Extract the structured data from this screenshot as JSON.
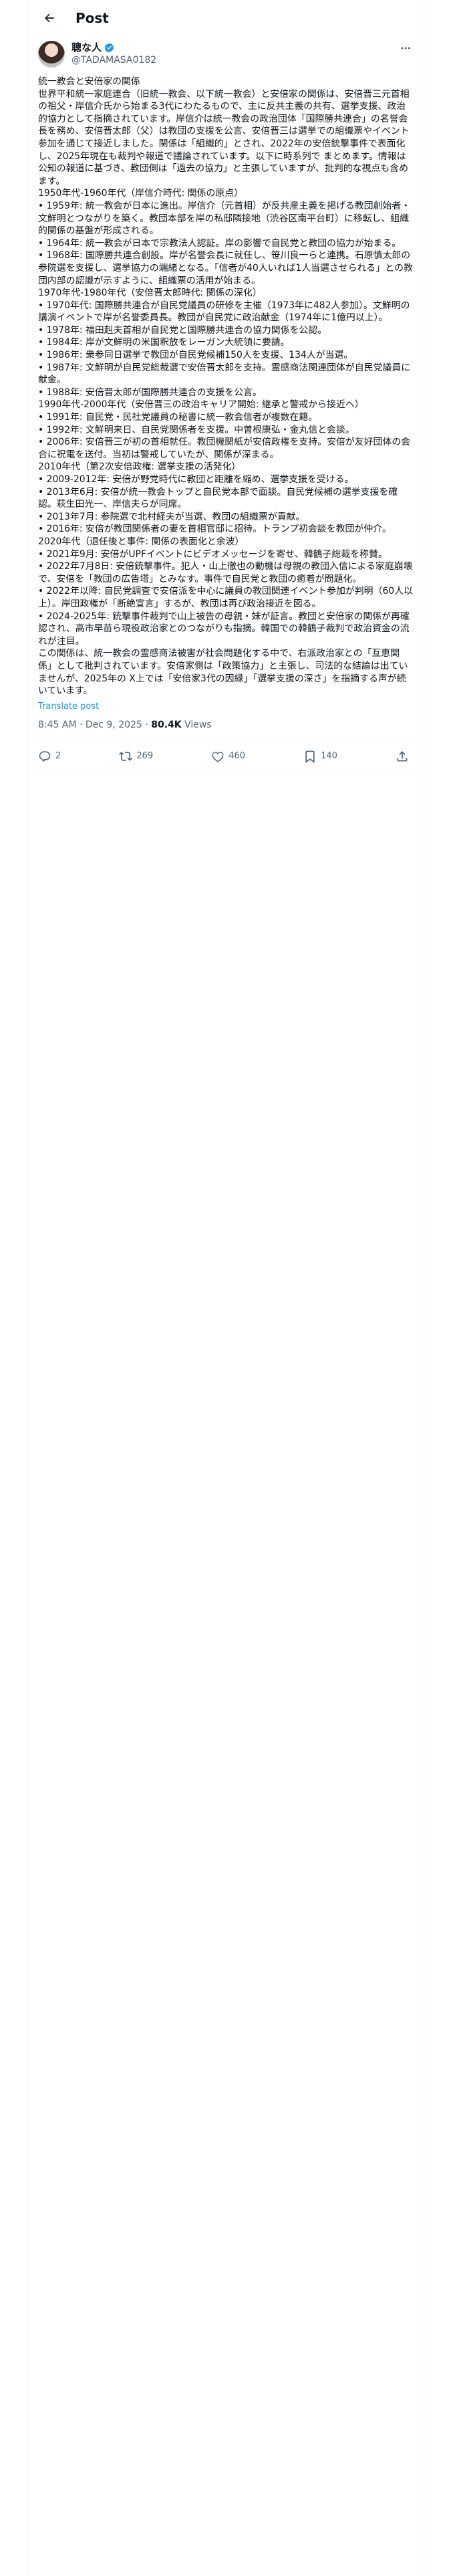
{
  "header": {
    "title": "Post"
  },
  "author": {
    "name": "聰な人",
    "handle": "@TADAMASA0182",
    "verified_color": "#1d9bf0"
  },
  "tweet": {
    "lines": [
      "統一教会と安倍家の関係",
      "世界平和統一家庭連合（旧統一教会、以下統一教会）と安倍家の関係は、安倍晋三元首相の祖父・岸信介氏から始まる3代にわたるもので、主に反共主義の共有、選挙支援、政治的協力として指摘されています。岸信介は統一教会の政治団体「国際勝共連合」の名誉会長を務め、安倍晋太郎（父）は教団の支援を公言、安倍晋三は選挙での組織票やイベント参加を通じて接近しました。関係は「組織的」とされ、2022年の安倍銃撃事件で表面化し、2025年現在も裁判や報道で議論されています。以下に時系列で まとめます。情報は公知の報道に基づき、教団側は「過去の協力」と主張していますが、批判的な視点も含めます。",
      "1950年代-1960年代（岸信介時代: 関係の原点）",
      "• 1959年: 統一教会が日本に進出。岸信介（元首相）が反共産主義を掲げる教団創始者・文鮮明とつながりを築く。教団本部を岸の私邸隣接地（渋谷区南平台町）に移転し、組織的関係の基盤が形成される。",
      "• 1964年: 統一教会が日本で宗教法人認証。岸の影響で自民党と教団の協力が始まる。",
      "• 1968年: 国際勝共連合創設。岸が名誉会長に就任し、笹川良一らと連携。石原慎太郎の参院選を支援し、選挙協力の端緒となる。「信者が40人いれば1人当選させられる」との教団内部の認識が示すように、組織票の活用が始まる。",
      "1970年代-1980年代（安倍晋太郎時代: 関係の深化）",
      "• 1970年代: 国際勝共連合が自民党議員の研修を主催（1973年に482人参加）。文鮮明の講演イベントで岸が名誉委員長。教団が自民党に政治献金（1974年に1億円以上）。",
      "• 1978年: 福田赳夫首相が自民党と国際勝共連合の協力関係を公認。",
      "• 1984年: 岸が文鮮明の米国釈放をレーガン大統領に要請。",
      "• 1986年: 衆参同日選挙で教団が自民党候補150人を支援、134人が当選。",
      "• 1987年: 文鮮明が自民党総裁選で安倍晋太郎を支持。霊感商法関連団体が自民党議員に献金。",
      "• 1988年: 安倍晋太郎が国際勝共連合の支援を公言。",
      "1990年代-2000年代（安倍晋三の政治キャリア開始: 継承と警戒から接近へ）",
      "• 1991年: 自民党・民社党議員の秘書に統一教会信者が複数在籍。",
      "• 1992年: 文鮮明来日、自民党関係者を支援。中曽根康弘・金丸信と会談。",
      "• 2006年: 安倍晋三が初の首相就任。教団機関紙が安倍政権を支持。安倍が友好団体の会合に祝電を送付。当初は警戒していたが、関係が深まる。",
      "2010年代（第2次安倍政権: 選挙支援の活発化）",
      "• 2009-2012年: 安倍が野党時代に教団と距離を縮め、選挙支援を受ける。",
      "• 2013年6月: 安倍が統一教会トップと自民党本部で面談。自民党候補の選挙支援を確認。萩生田光一、岸信夫らが同席。",
      "• 2013年7月: 参院選で北村経夫が当選、教団の組織票が貢献。",
      "• 2016年: 安倍が教団関係者の妻を首相官邸に招待。トランプ初会談を教団が仲介。",
      "2020年代（退任後と事件: 関係の表面化と余波）",
      "• 2021年9月: 安倍がUPFイベントにビデオメッセージを寄せ、韓鶴子総裁を称賛。",
      "• 2022年7月8日: 安倍銃撃事件。犯人・山上徹也の動機は母親の教団入信による家庭崩壊で、安倍を「教団の広告塔」とみなす。事件で自民党と教団の癒着が問題化。",
      "• 2022年以降: 自民党調査で安倍派を中心に議員の教団関連イベント参加が判明（60人以上）。岸田政権が「断絶宣言」するが、教団は再び政治接近を図る。",
      "• 2024-2025年: 銃撃事件裁判で山上被告の母親・妹が証言。教団と安倍家の関係が再確認され、高市早苗ら現役政治家とのつながりも指摘。韓国での韓鶴子裁判で政治資金の流れが注目。",
      "この関係は、統一教会の霊感商法被害が社会問題化する中で、右派政治家との「互恵関係」として批判されています。安倍家側は「政策協力」と主張し、司法的な結論は出ていませんが、2025年の X上では「安倍家3代の因縁」「選挙支援の深さ」を指摘する声が続いています。"
    ],
    "translate_label": "Translate post",
    "timestamp": "8:45 AM · Dec 9, 2025",
    "separator": " · ",
    "views_count": "80.4K",
    "views_label": " Views"
  },
  "actions": {
    "reply": {
      "icon": "reply-icon",
      "count": "2"
    },
    "repost": {
      "icon": "repost-icon",
      "count": "269"
    },
    "like": {
      "icon": "heart-icon",
      "count": "460"
    },
    "bookmark": {
      "icon": "bookmark-icon",
      "count": "140"
    },
    "share": {
      "icon": "share-icon"
    }
  }
}
